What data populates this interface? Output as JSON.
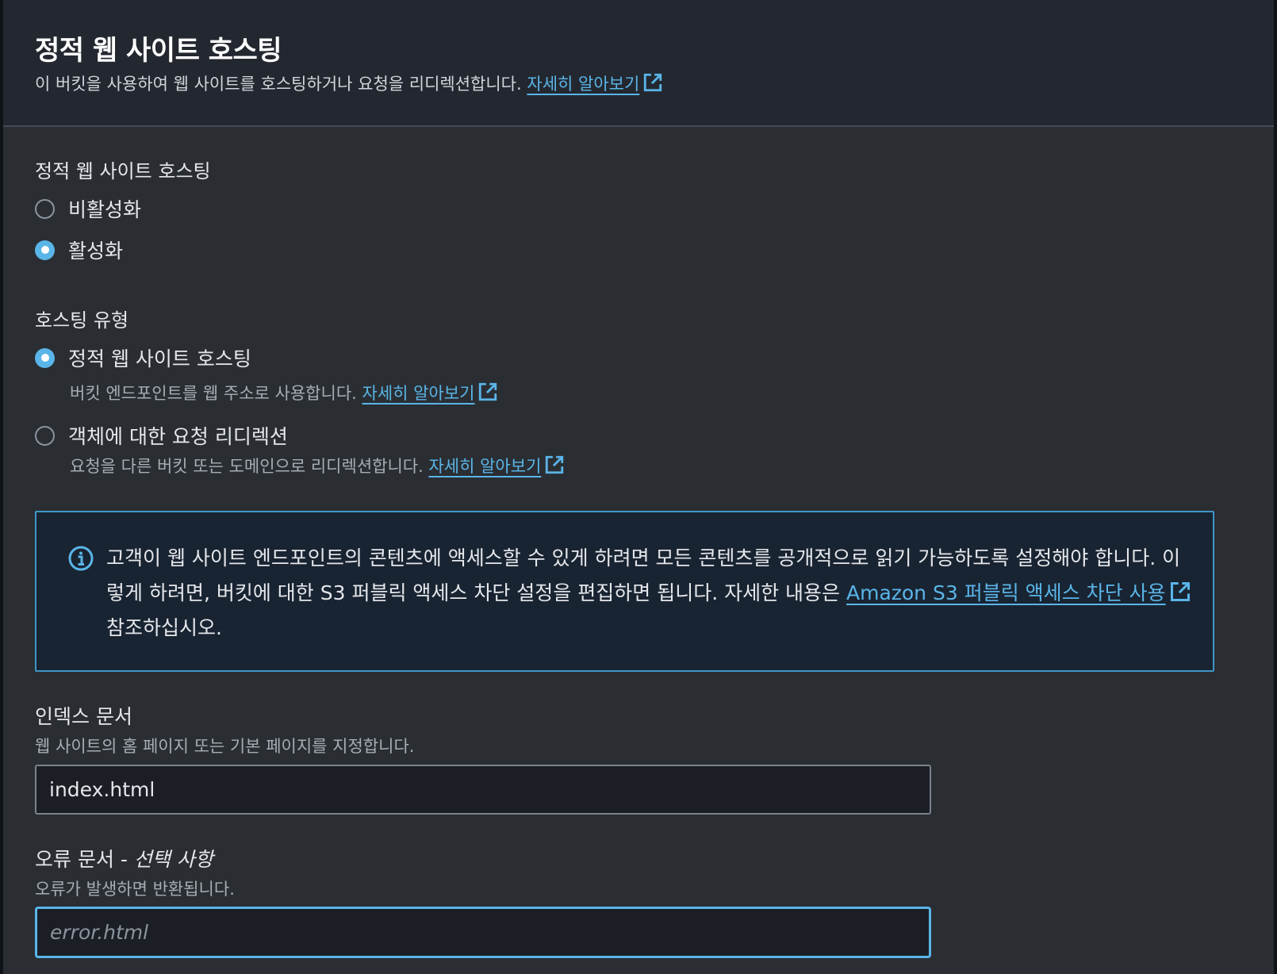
{
  "header": {
    "title": "정적 웹 사이트 호스팅",
    "description": "이 버킷을 사용하여 웹 사이트를 호스팅하거나 요청을 리디렉션합니다.",
    "learn_more": "자세히 알아보기"
  },
  "static_hosting": {
    "label": "정적 웹 사이트 호스팅",
    "options": [
      {
        "label": "비활성화",
        "selected": false
      },
      {
        "label": "활성화",
        "selected": true
      }
    ]
  },
  "hosting_type": {
    "label": "호스팅 유형",
    "options": [
      {
        "label": "정적 웹 사이트 호스팅",
        "description": "버킷 엔드포인트를 웹 주소로 사용합니다.",
        "learn_more": "자세히 알아보기",
        "selected": true
      },
      {
        "label": "객체에 대한 요청 리디렉션",
        "description": "요청을 다른 버킷 또는 도메인으로 리디렉션합니다.",
        "learn_more": "자세히 알아보기",
        "selected": false
      }
    ]
  },
  "info_alert": {
    "text_before_link": "고객이 웹 사이트 엔드포인트의 콘텐츠에 액세스할 수 있게 하려면 모든 콘텐츠를 공개적으로 읽기 가능하도록 설정해야 합니다. 이렇게 하려면, 버킷에 대한 S3 퍼블릭 액세스 차단 설정을 편집하면 됩니다. 자세한 내용은 ",
    "link": "Amazon S3 퍼블릭 액세스 차단 사용",
    "text_after_link": " 참조하십시오."
  },
  "index_document": {
    "label": "인덱스 문서",
    "description": "웹 사이트의 홈 페이지 또는 기본 페이지를 지정합니다.",
    "value": "index.html"
  },
  "error_document": {
    "label": "오류 문서 - ",
    "optional": "선택 사항",
    "description": "오류가 발생하면 반환됩니다.",
    "placeholder": "error.html"
  },
  "colors": {
    "accent": "#5ab5e8",
    "panel": "#2a2e33",
    "header": "#232830",
    "info_bg": "#192432"
  }
}
